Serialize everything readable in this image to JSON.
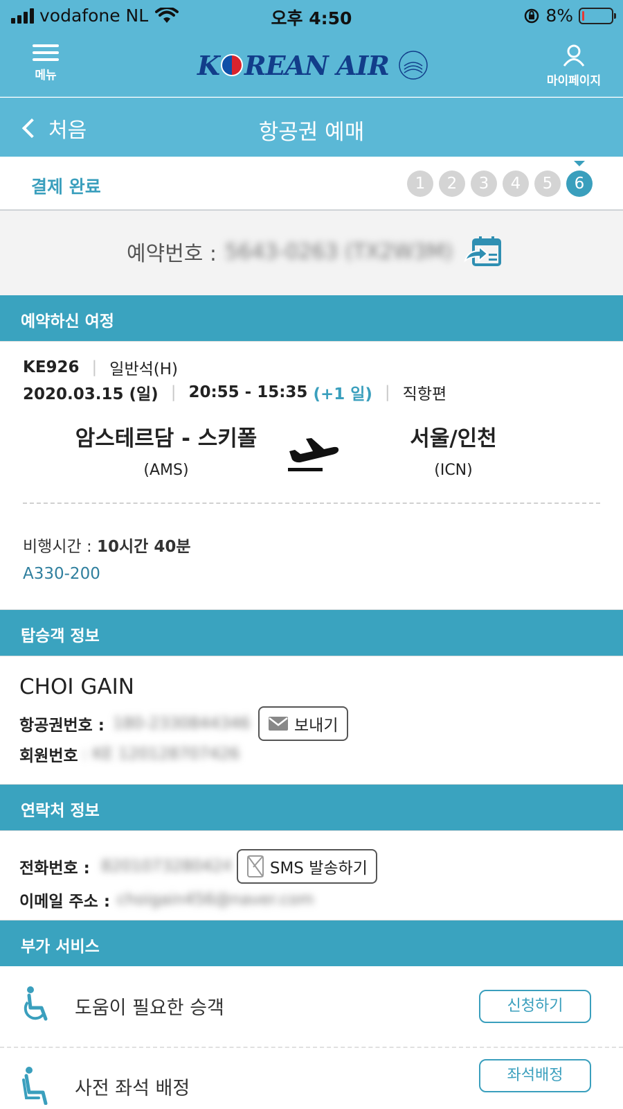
{
  "status_bar": {
    "carrier": "vodafone NL",
    "time": "오후 4:50",
    "battery": "8%",
    "battery_level": 0.08
  },
  "header": {
    "menu_label": "메뉴",
    "logo_text_a": "K",
    "logo_text_b": "REAN AIR",
    "mypage_label": "마이페이지"
  },
  "title_bar": {
    "back_label": "처음",
    "title": "항공권 예매"
  },
  "steps": {
    "label": "결제 완료",
    "items": [
      "1",
      "2",
      "3",
      "4",
      "5",
      "6"
    ],
    "current": 6
  },
  "reservation": {
    "label": "예약번호 :",
    "number": "5643-0263 (TX2W3M)"
  },
  "itinerary": {
    "section_title": "예약하신 여정",
    "flight_no": "KE926",
    "cabin": "일반석(H)",
    "date": "2020.03.15 (일)",
    "time_range": "20:55 - 15:35",
    "day_offset": "(+1 일)",
    "flight_type": "직항편",
    "origin_city": "암스테르담 - 스키폴",
    "origin_code": "(AMS)",
    "dest_city": "서울/인천",
    "dest_code": "(ICN)",
    "duration_label": "비행시간 :",
    "duration": "10시간 40분",
    "aircraft": "A330-200"
  },
  "passenger": {
    "section_title": "탑승객 정보",
    "name": "CHOI GAIN",
    "ticket_label": "항공권번호 :",
    "ticket_number": "180-2330844346",
    "send_label": "보내기",
    "member_label": "회원번호",
    "member_number": ": KE 120128707426"
  },
  "contact": {
    "section_title": "연락처 정보",
    "phone_label": "전화번호 :",
    "phone_value": "8201073280424",
    "sms_label": "SMS 발송하기",
    "email_label": "이메일 주소 :",
    "email_value": "choigain456@naver.com"
  },
  "extra": {
    "section_title": "부가 서비스",
    "services": [
      {
        "label": "도움이 필요한 승객",
        "button": "신청하기",
        "icon": "wheelchair-icon"
      },
      {
        "label": "사전 좌석 배정",
        "button": "좌석배정",
        "icon": "seat-icon"
      }
    ]
  },
  "colors": {
    "header_bg": "#5bb8d6",
    "section_bg": "#3aa3bf",
    "accent": "#3a9fbd"
  }
}
